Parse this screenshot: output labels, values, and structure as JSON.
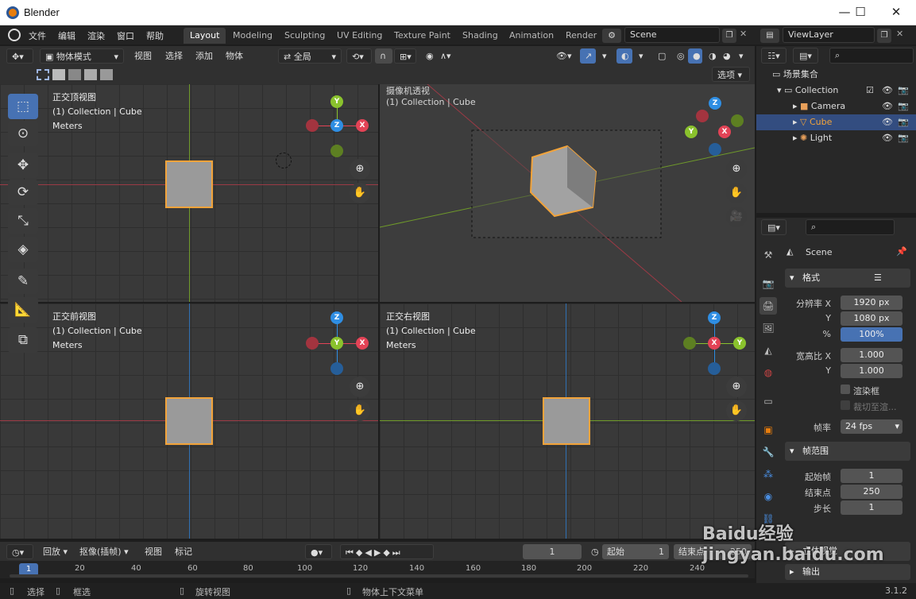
{
  "window": {
    "title": "Blender",
    "minimize": "—",
    "maximize": "☐",
    "close": "✕"
  },
  "menu": [
    "文件",
    "编辑",
    "渲染",
    "窗口",
    "帮助"
  ],
  "workspaces": [
    "Layout",
    "Modeling",
    "Sculpting",
    "UV Editing",
    "Texture Paint",
    "Shading",
    "Animation",
    "Render"
  ],
  "scene_name": "Scene",
  "view_layer": "ViewLayer",
  "viewport_header": {
    "mode": "物体模式",
    "menus": [
      "视图",
      "选择",
      "添加",
      "物体"
    ],
    "transform": "全局",
    "options": "选项"
  },
  "viewports": [
    {
      "title": "正交顶视图",
      "collection": "(1) Collection | Cube",
      "units": "Meters",
      "gizmo": [
        "Y",
        "Z",
        "X"
      ]
    },
    {
      "title": "摄像机透视",
      "collection": "(1) Collection | Cube",
      "units": "",
      "gizmo": [
        "Z",
        "Y",
        "X"
      ]
    },
    {
      "title": "正交前视图",
      "collection": "(1) Collection | Cube",
      "units": "Meters",
      "gizmo": [
        "Z",
        "Y",
        "X"
      ]
    },
    {
      "title": "正交右视图",
      "collection": "(1) Collection | Cube",
      "units": "Meters",
      "gizmo": [
        "Z",
        "X",
        "Y"
      ]
    }
  ],
  "outliner": {
    "root": "场景集合",
    "items": [
      {
        "name": "Collection",
        "level": 0
      },
      {
        "name": "Camera",
        "level": 1
      },
      {
        "name": "Cube",
        "level": 1,
        "selected": true
      },
      {
        "name": "Light",
        "level": 1
      }
    ]
  },
  "properties": {
    "context": "Scene",
    "format_panel": "格式",
    "resolution_x_label": "分辨率 X",
    "resolution_x": "1920 px",
    "resolution_y_label": "Y",
    "resolution_y": "1080 px",
    "percent_label": "%",
    "percent": "100%",
    "aspect_x_label": "宽高比 X",
    "aspect_x": "1.000",
    "aspect_y_label": "Y",
    "aspect_y": "1.000",
    "render_border": "渲染框",
    "crop": "裁切至渲...",
    "fps_label": "帧率",
    "fps": "24 fps",
    "frame_range_panel": "帧范围",
    "frame_start_label": "起始帧",
    "frame_start": "1",
    "frame_end_label": "结束点",
    "frame_end": "250",
    "step_label": "步长",
    "step": "1",
    "stereo_panel": "立体视觉",
    "output_panel": "输出"
  },
  "timeline": {
    "playback": "回放",
    "keying": "抠像(插帧)",
    "view": "视图",
    "marker": "标记",
    "current_frame": "1",
    "start_label": "起始",
    "start": "1",
    "end_label": "结束点",
    "end": "250",
    "ticks": [
      "1",
      "20",
      "40",
      "60",
      "80",
      "100",
      "120",
      "140",
      "160",
      "180",
      "200",
      "220",
      "240"
    ]
  },
  "status": {
    "select": "选择",
    "box": "框选",
    "rotate": "旋转视图",
    "context_menu": "物体上下文菜单",
    "version": "3.1.2"
  },
  "watermark": "Baidu经验 jingyan.baidu.com",
  "colors": {
    "x": "#e34356",
    "y": "#8ac22d",
    "z": "#2f8ee3",
    "selected": "#f2a33a",
    "accent": "#4772b3"
  }
}
